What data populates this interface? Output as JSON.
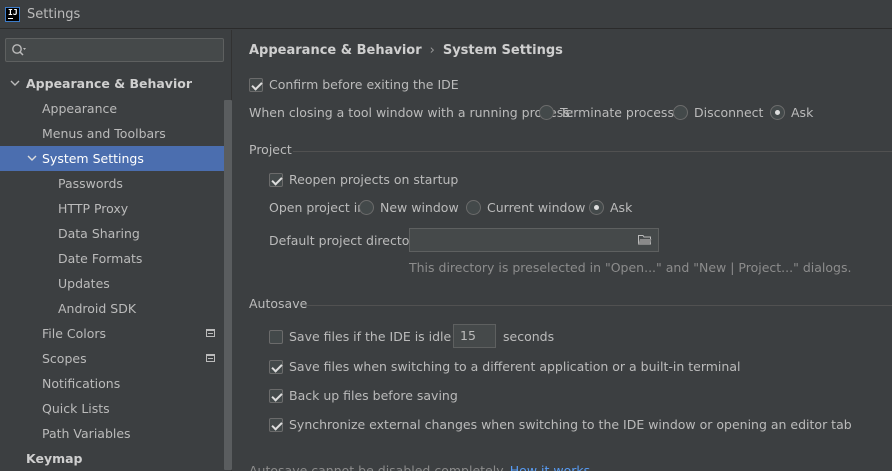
{
  "window": {
    "title": "Settings",
    "logo_text": "IJ"
  },
  "search": {
    "placeholder": "",
    "value": ""
  },
  "tree": {
    "appearance_behavior": "Appearance & Behavior",
    "appearance": "Appearance",
    "menus_toolbars": "Menus and Toolbars",
    "system_settings": "System Settings",
    "passwords": "Passwords",
    "http_proxy": "HTTP Proxy",
    "data_sharing": "Data Sharing",
    "date_formats": "Date Formats",
    "updates": "Updates",
    "android_sdk": "Android SDK",
    "file_colors": "File Colors",
    "scopes": "Scopes",
    "notifications": "Notifications",
    "quick_lists": "Quick Lists",
    "path_variables": "Path Variables",
    "keymap": "Keymap"
  },
  "breadcrumb": {
    "parent": "Appearance & Behavior",
    "separator": "›",
    "current": "System Settings"
  },
  "general": {
    "confirm_exit": {
      "label": "Confirm before exiting the IDE",
      "checked": true
    },
    "closing_label": "When closing a tool window with a running process:",
    "closing_options": [
      "Terminate process",
      "Disconnect",
      "Ask"
    ],
    "closing_selected": "Ask"
  },
  "project": {
    "title": "Project",
    "reopen": {
      "label": "Reopen projects on startup",
      "checked": true
    },
    "open_label": "Open project in",
    "open_options": [
      "New window",
      "Current window",
      "Ask"
    ],
    "open_selected": "Ask",
    "dir_label": "Default project directory:",
    "dir_value": "",
    "dir_hint": "This directory is preselected in \"Open...\" and \"New | Project...\" dialogs."
  },
  "autosave": {
    "title": "Autosave",
    "idle": {
      "label": "Save files if the IDE is idle for",
      "checked": false,
      "value": "15",
      "unit": "seconds"
    },
    "switching": {
      "label": "Save files when switching to a different application or a built-in terminal",
      "checked": true
    },
    "backup": {
      "label": "Back up files before saving",
      "checked": true
    },
    "sync": {
      "label": "Synchronize external changes when switching to the IDE window or opening an editor tab",
      "checked": true
    },
    "note": "Autosave cannot be disabled completely.",
    "note_link": "How it works"
  },
  "colors": {
    "selection": "#4b6eaf",
    "background": "#3c3f41",
    "link": "#589df6"
  }
}
